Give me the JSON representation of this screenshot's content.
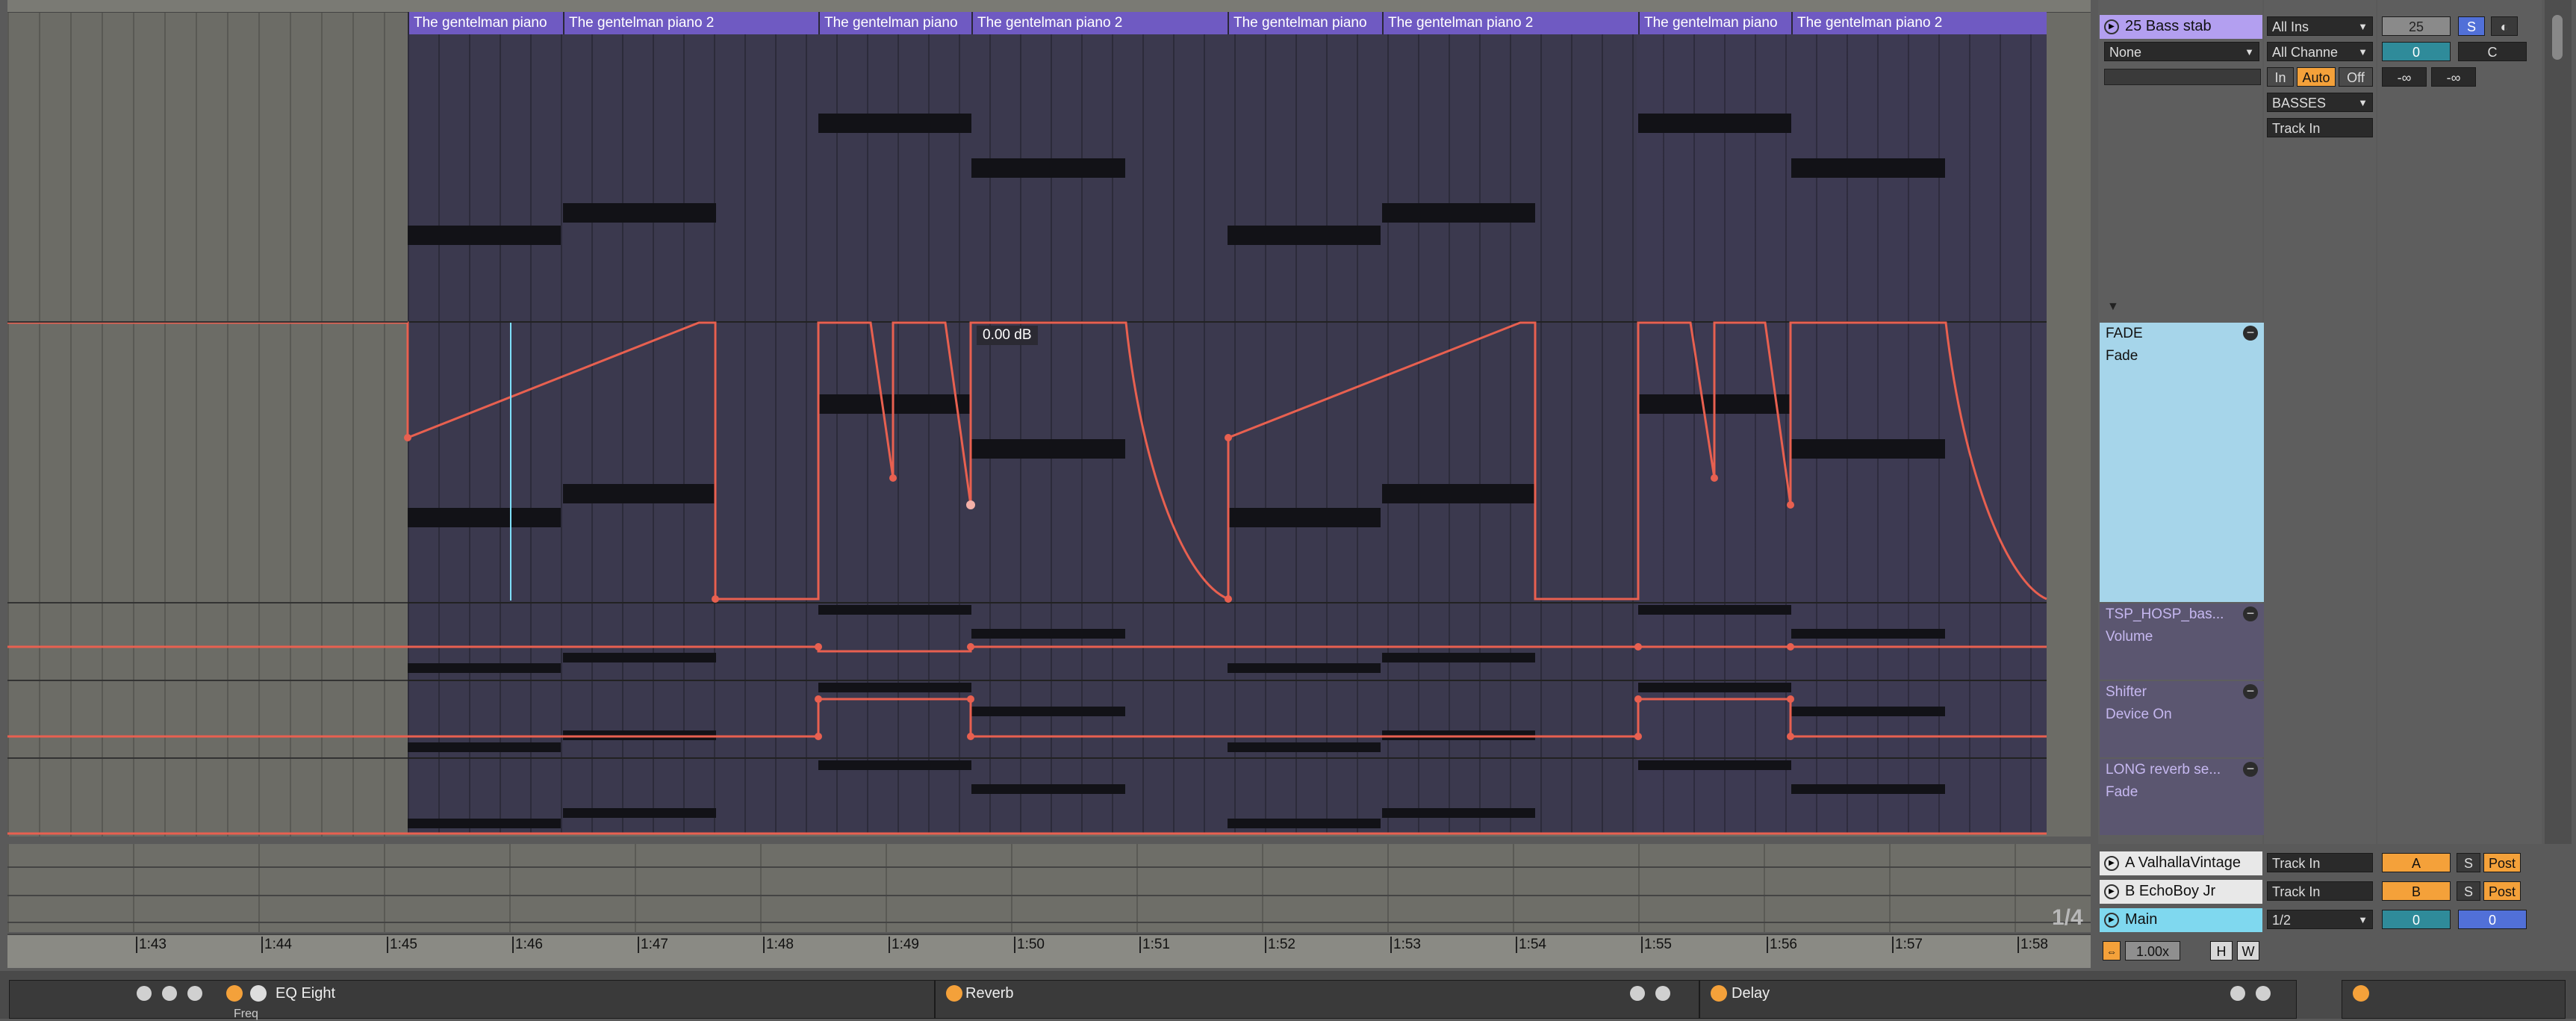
{
  "arrangement": {
    "clip_name": "The gentelman piano",
    "clip_name_2": "The gentelman piano 2",
    "value_popup": "0.00 dB"
  },
  "track": {
    "name": "25 Bass stab",
    "input_type": "All Ins",
    "input_channel": "All Channe",
    "input_none": "None",
    "monitor_in": "In",
    "monitor_auto": "Auto",
    "monitor_off": "Off",
    "output": "BASSES",
    "output_channel": "Track In",
    "track_number": "25",
    "solo": "S",
    "volume": "0",
    "pan": "C",
    "peak_left": "-∞",
    "peak_right": "-∞"
  },
  "lanes": [
    {
      "device": "FADE",
      "param": "Fade"
    },
    {
      "device": "TSP_HOSP_bas...",
      "param": "Volume"
    },
    {
      "device": "Shifter",
      "param": "Device On"
    },
    {
      "device": "LONG reverb se...",
      "param": "Fade"
    }
  ],
  "returns": [
    {
      "name": "A ValhallaVintage",
      "input": "Track In",
      "letter": "A",
      "solo": "S",
      "post": "Post"
    },
    {
      "name": "B EchoBoy Jr",
      "input": "Track In",
      "letter": "B",
      "solo": "S",
      "post": "Post"
    }
  ],
  "main": {
    "name": "Main",
    "output": "1/2",
    "vol": "0",
    "pan": "0"
  },
  "grid": {
    "fraction": "1/4",
    "zoom": "1.00x",
    "h": "H",
    "w": "W"
  },
  "ruler": [
    "1:43",
    "1:44",
    "1:45",
    "1:46",
    "1:47",
    "1:48",
    "1:49",
    "1:50",
    "1:51",
    "1:52",
    "1:53",
    "1:54",
    "1:55",
    "1:56",
    "1:57",
    "1:58"
  ],
  "devices": [
    {
      "name": "EQ Eight",
      "sub": "Freq"
    },
    {
      "name": "Reverb"
    },
    {
      "name": "Delay"
    }
  ],
  "icons": [
    "play-icon",
    "minus-circle-icon",
    "power-icon",
    "save-icon",
    "more-icon",
    "dropdown-arrow-icon"
  ],
  "colors": {
    "clip_header": "#6f5ac2",
    "automation": "#e86050",
    "selected_lane": "#a6d5ea",
    "main_track": "#7fd8ef",
    "auto_button": "#f4a13a"
  }
}
